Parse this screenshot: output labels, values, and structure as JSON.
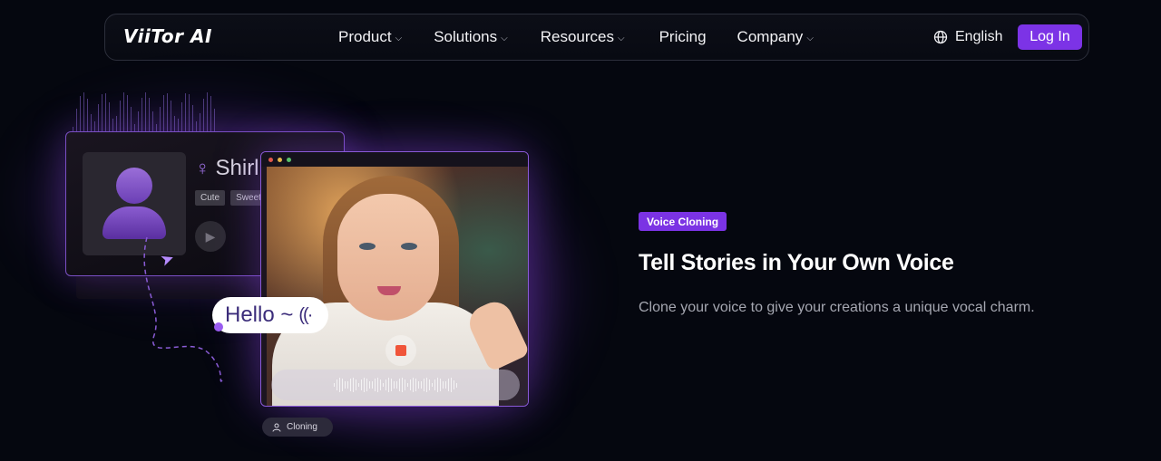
{
  "header": {
    "logo_text": "ViiTor AI",
    "nav": [
      {
        "label": "Product",
        "has_dropdown": true
      },
      {
        "label": "Solutions",
        "has_dropdown": true
      },
      {
        "label": "Resources",
        "has_dropdown": true
      },
      {
        "label": "Pricing",
        "has_dropdown": false
      },
      {
        "label": "Company",
        "has_dropdown": true
      }
    ],
    "language": {
      "label": "English",
      "icon": "globe-icon"
    },
    "login_label": "Log In"
  },
  "illustration": {
    "voice_card": {
      "name": "Shirl",
      "tags": [
        "Cute",
        "Sweet"
      ]
    },
    "speech_bubble": "Hello ~",
    "status_badge": "Cloning"
  },
  "hero": {
    "badge": "Voice Cloning",
    "title": "Tell Stories in Your Own Voice",
    "description": "Clone your voice to give your creations a unique vocal charm."
  },
  "colors": {
    "background": "#05070f",
    "accent": "#7c33e6",
    "muted_text": "#a5a7b1"
  }
}
